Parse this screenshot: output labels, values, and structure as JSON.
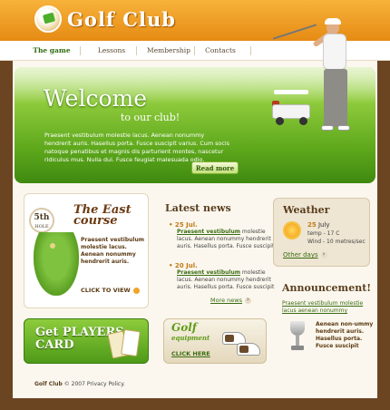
{
  "header": {
    "logo_text": "Golf Club"
  },
  "nav": {
    "items": [
      "The game",
      "Lessons",
      "Membership",
      "Contacts"
    ]
  },
  "hero": {
    "title": "Welcome",
    "subtitle": "to our club!",
    "text": "Praesent vestibulum molestie lacus. Aenean nonummy hendrerit auris. Hasellus porta. Fusce suscipit varius. Cum socis natoque penatibus et magnis dis parturient montes, nascetur ridiculus mus. Nulla dui. Fusce feugiat malesuada odio.",
    "read_more": "Read more"
  },
  "promo": {
    "hole_number": "5th",
    "hole_label": "HOLE",
    "title": "The East course",
    "text": "Praesent vestibulum molestie lacus. Aenean nonummy hendrerit auris.",
    "click": "CLICK TO VIEW"
  },
  "news": {
    "title": "Latest news",
    "items": [
      {
        "date": "25 Jul.",
        "link": "Praesent vestibulum",
        "body": "molestie lacus. Aenean nonummy hendrerit auris. Hasellus porta. Fusce suscipit"
      },
      {
        "date": "20 Jul.",
        "link": "Praesent vestibulum",
        "body": "molestie lacus. Aenean nonummy hendrerit auris. Hasellus porta. Fusce suscipit"
      }
    ],
    "more": "More news"
  },
  "weather": {
    "title": "Weather",
    "day": "25",
    "month": "July",
    "temp": "temp - 17 C",
    "wind": "Wind - 10 metres/sec",
    "other_days": "Other days"
  },
  "announcement": {
    "title": "Announcement!",
    "link": "Praesent vestibulum molestie lacus aenean nonummy",
    "text": "Aenean non-ummy hendrerit auris. Hasellus porta. Fusce suscipit"
  },
  "players_card": {
    "line1": "Get PLAYERS",
    "line2": "CARD"
  },
  "equipment": {
    "title": "Golf",
    "subtitle": "equipment",
    "click": "CLICK HERE"
  },
  "footer": {
    "brand": "Golf Club",
    "copy": "© 2007",
    "policy": "Privacy Policy."
  },
  "colors": {
    "header_orange": "#e68b14",
    "hero_green": "#5ea81c",
    "link_green": "#3a6d12",
    "accent_brown": "#6b4422"
  }
}
